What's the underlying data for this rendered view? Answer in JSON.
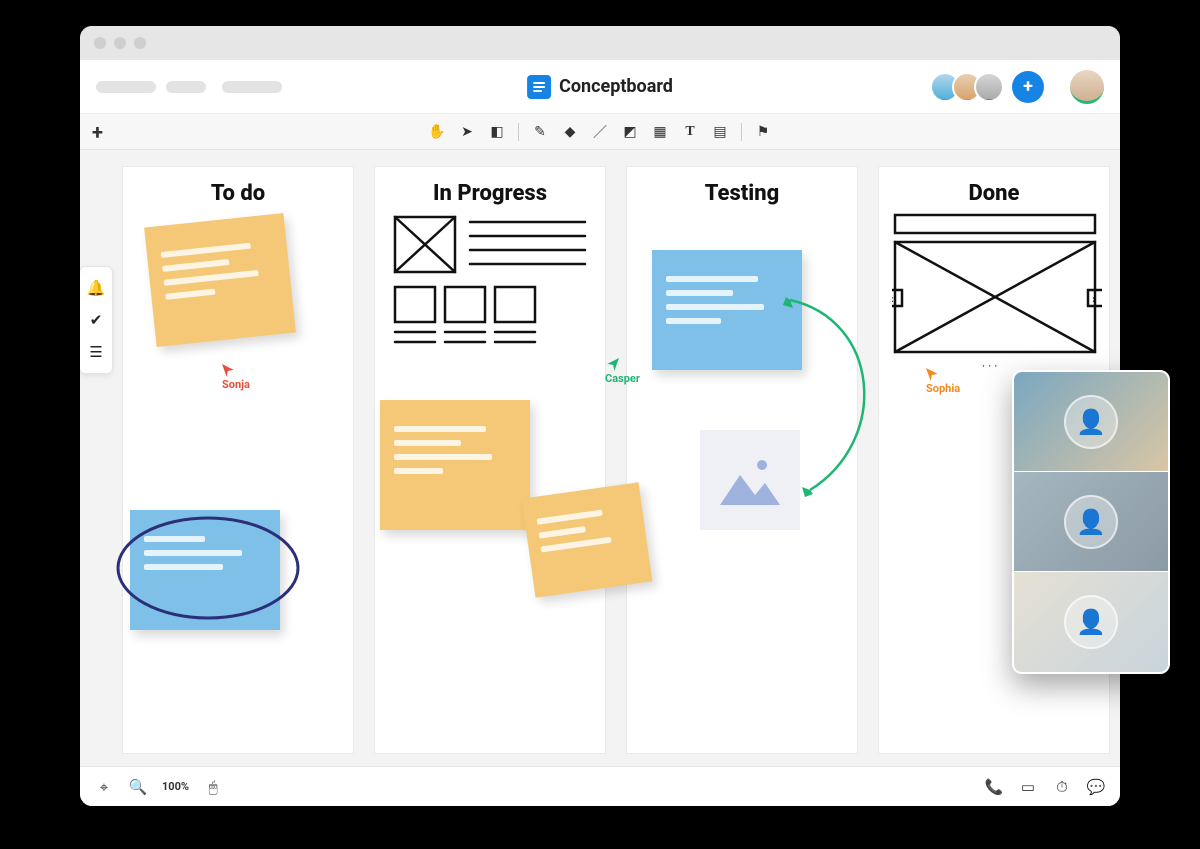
{
  "brand": {
    "name": "Conceptboard"
  },
  "header": {
    "add_label": "+",
    "users": [
      "User 1",
      "User 2",
      "User 3"
    ],
    "plus": "+"
  },
  "toolbar": {
    "add_tab": "+",
    "tools": [
      "hand",
      "pointer",
      "eraser",
      "pen",
      "highlighter",
      "line",
      "shape",
      "table",
      "text",
      "note",
      "comment"
    ]
  },
  "columns": [
    {
      "title": "To do"
    },
    {
      "title": "In Progress"
    },
    {
      "title": "Testing"
    },
    {
      "title": "Done"
    }
  ],
  "cursors": {
    "sonja": {
      "label": "Sonja",
      "color": "#e84f3d"
    },
    "casper": {
      "label": "Casper",
      "color": "#1db673"
    },
    "sophia": {
      "label": "Sophia",
      "color": "#f08a1e"
    }
  },
  "footer": {
    "zoom": "100%"
  },
  "sidebar": {
    "items": [
      "notifications",
      "tasks",
      "outline"
    ]
  },
  "video": {
    "participants": [
      "Participant 1",
      "Participant 2",
      "Participant 3"
    ]
  },
  "colors": {
    "brand_blue": "#1684e5",
    "note_yellow": "#f4c876",
    "note_blue": "#7ec0e8"
  }
}
